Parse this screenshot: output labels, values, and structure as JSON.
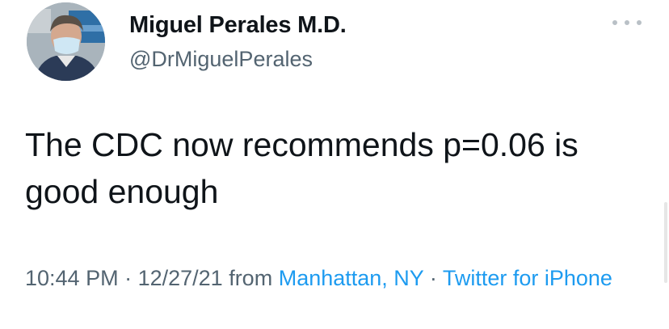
{
  "tweet": {
    "author_name": "Miguel Perales M.D.",
    "handle": "@DrMiguelPerales",
    "text": "The CDC now recommends p=0.06 is good enough",
    "time": "10:44 PM",
    "separator_1": " · ",
    "date": "12/27/21",
    "from_label": " from ",
    "location": "Manhattan, NY",
    "separator_2": " · ",
    "source": "Twitter for iPhone"
  },
  "icons": {
    "more": "more-options-icon"
  },
  "colors": {
    "text": "#0f1419",
    "secondary": "#536471",
    "link": "#1d9bf0",
    "background": "#ffffff"
  }
}
